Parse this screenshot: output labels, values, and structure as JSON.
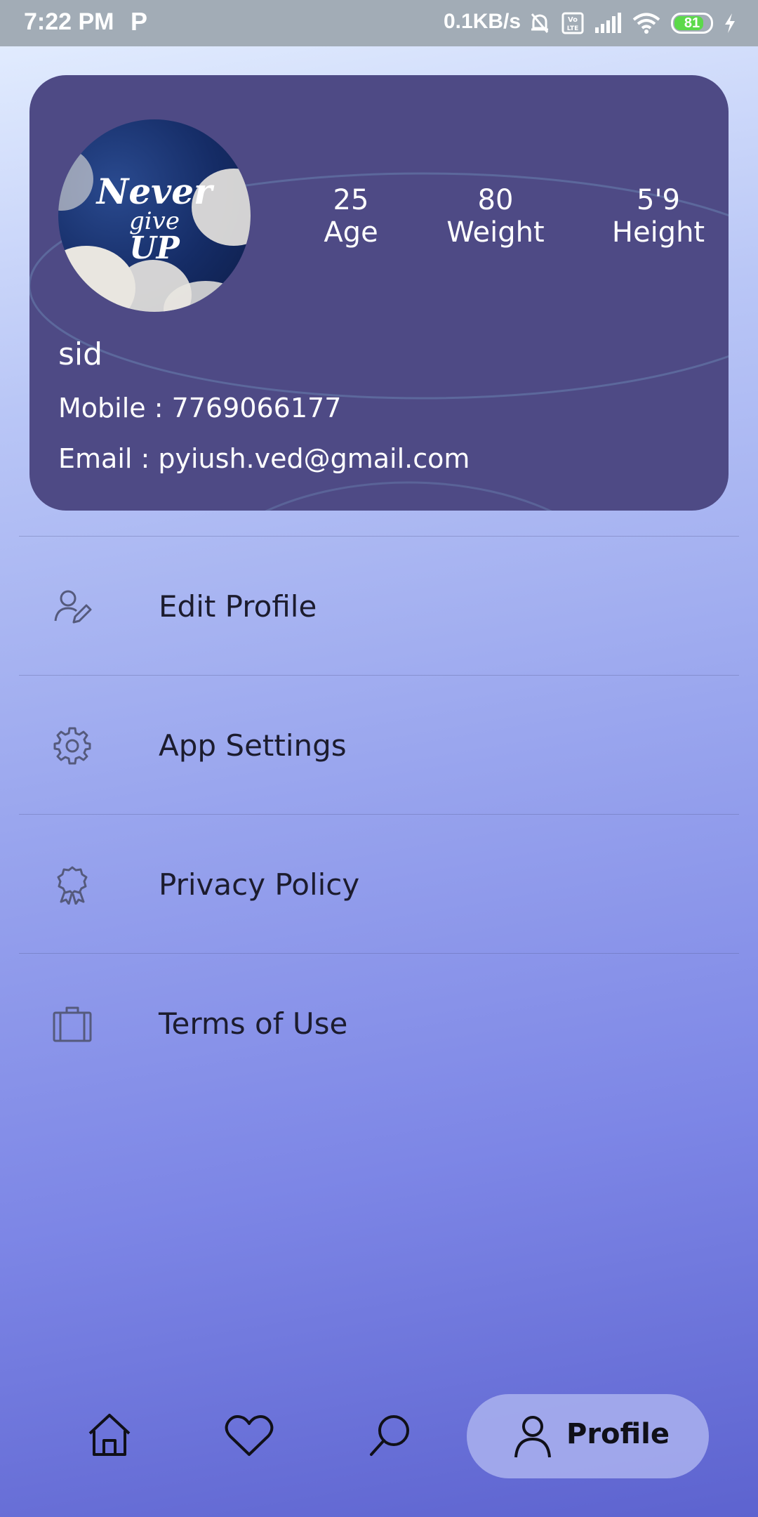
{
  "status_bar": {
    "time": "7:22 PM",
    "app_icon_letter": "P",
    "network_speed": "0.1KB/s",
    "battery_level": "81",
    "battery_fraction": 0.81,
    "icons": [
      "mute-bell-icon",
      "volte-icon",
      "signal-icon",
      "wifi-icon",
      "battery-icon",
      "charging-bolt-icon"
    ]
  },
  "profile": {
    "avatar_text": {
      "line1": "Never",
      "line2": "give",
      "line3": "UP"
    },
    "stats": [
      {
        "value": "25",
        "label": "Age"
      },
      {
        "value": "80",
        "label": "Weight"
      },
      {
        "value": "5'9",
        "label": "Height"
      }
    ],
    "name": "sid",
    "mobile": "Mobile : 7769066177",
    "email": "Email : pyiush.ved@gmail.com"
  },
  "menu": {
    "items": [
      {
        "label": "Edit Profile",
        "icon": "edit-profile-icon"
      },
      {
        "label": "App Settings",
        "icon": "gear-icon"
      },
      {
        "label": "Privacy Policy",
        "icon": "badge-icon"
      },
      {
        "label": "Terms of Use",
        "icon": "briefcase-icon"
      }
    ]
  },
  "bottom_nav": {
    "items": [
      "home-icon",
      "heart-icon",
      "search-icon",
      "profile-icon"
    ],
    "active_label": "Profile"
  },
  "colors": {
    "card": "#4e4a85",
    "text_dark": "#1c1c2e",
    "nav_active_pill": "#aab2ee",
    "status_bar": "#a2acb6"
  }
}
